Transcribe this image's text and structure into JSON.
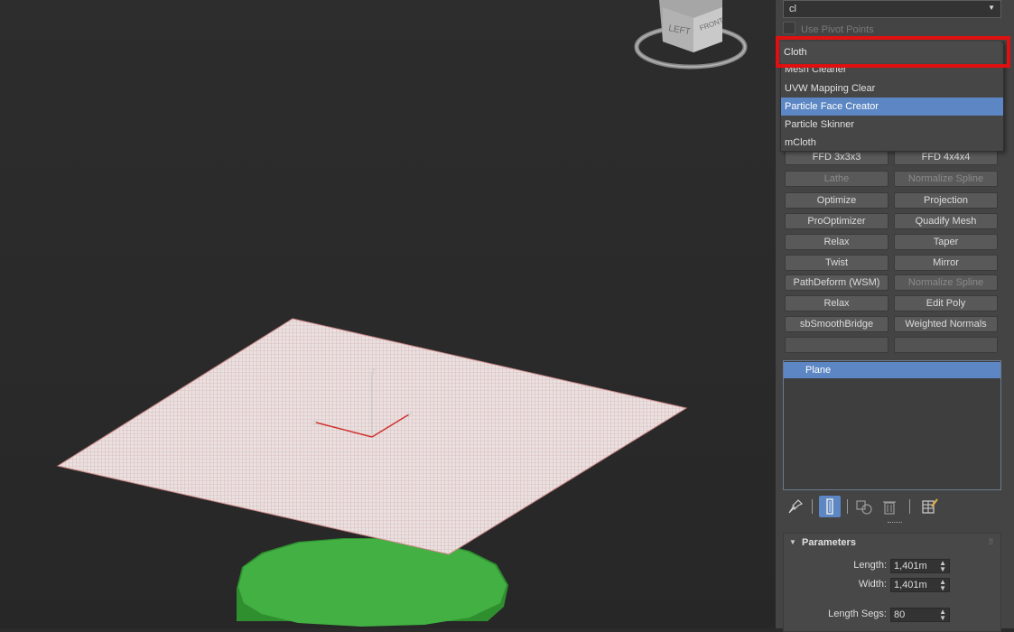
{
  "modifier_search": {
    "value": "cl"
  },
  "use_pivot_points": {
    "label": "Use Pivot Points"
  },
  "dropdown": {
    "highlighted": "Cloth",
    "items": [
      {
        "label": "Mesh Cleaner",
        "selected": false
      },
      {
        "label": "UVW Mapping Clear",
        "selected": false
      },
      {
        "label": "Particle Face Creator",
        "selected": true
      },
      {
        "label": "Particle Skinner",
        "selected": false
      },
      {
        "label": "mCloth",
        "selected": false
      }
    ]
  },
  "modifier_buttons": [
    {
      "label": "FFD 3x3x3",
      "enabled": true
    },
    {
      "label": "FFD 4x4x4",
      "enabled": true
    },
    {
      "label": "Lathe",
      "enabled": false
    },
    {
      "label": "Normalize Spline",
      "enabled": false
    },
    {
      "label": "Optimize",
      "enabled": true
    },
    {
      "label": "Projection",
      "enabled": true
    },
    {
      "label": "ProOptimizer",
      "enabled": true
    },
    {
      "label": "Quadify Mesh",
      "enabled": true
    },
    {
      "label": "Relax",
      "enabled": true
    },
    {
      "label": "Taper",
      "enabled": true
    },
    {
      "label": "Twist",
      "enabled": true
    },
    {
      "label": "Mirror",
      "enabled": true
    },
    {
      "label": "PathDeform (WSM)",
      "enabled": true
    },
    {
      "label": "Normalize Spline",
      "enabled": false
    },
    {
      "label": "Relax",
      "enabled": true
    },
    {
      "label": "Edit Poly",
      "enabled": true
    },
    {
      "label": "sbSmoothBridge",
      "enabled": true
    },
    {
      "label": "Weighted Normals",
      "enabled": true
    },
    {
      "label": "",
      "enabled": true
    },
    {
      "label": "",
      "enabled": true
    }
  ],
  "modifier_stack": {
    "items": [
      "Plane"
    ]
  },
  "viewcube": {
    "left": "LEFT",
    "front": "FRONT"
  },
  "gizmo": {
    "z": "z",
    "x": "x",
    "y": "y"
  },
  "parameters": {
    "title": "Parameters",
    "length": {
      "label": "Length:",
      "value": "1,401m"
    },
    "width": {
      "label": "Width:",
      "value": "1,401m"
    },
    "length_segs": {
      "label": "Length Segs:",
      "value": "80"
    }
  },
  "colors": {
    "accent": "#5c87c4",
    "highlight_box": "#e01010",
    "plane_wire": "#c8a0a0",
    "cylinder": "#3ca83c"
  }
}
